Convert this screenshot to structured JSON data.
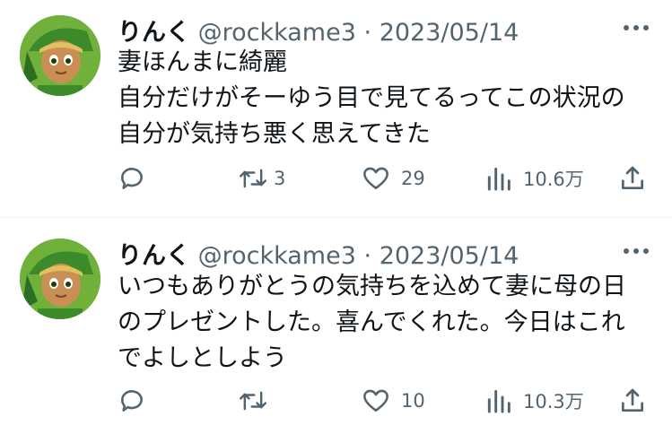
{
  "tweets": [
    {
      "author_name": "りんく",
      "handle": "@rockkame3",
      "separator": "·",
      "date": "2023/05/14",
      "lines": [
        "妻ほんまに綺麗",
        "自分だけがそーゆう目で見てるってこの状況の",
        "自分が気持ち悪く思えてきた"
      ],
      "actions": {
        "reply_count": "",
        "retweet_count": "3",
        "like_count": "29",
        "views_count": "10.6万"
      },
      "icons": [
        "reply-icon",
        "retweet-icon",
        "like-icon",
        "views-icon",
        "share-icon",
        "more-icon"
      ]
    },
    {
      "author_name": "りんく",
      "handle": "@rockkame3",
      "separator": "·",
      "date": "2023/05/14",
      "lines": [
        "いつもありがとうの気持ちを込めて妻に母の日",
        "のプレゼントした。喜んでくれた。今日はこれ",
        "でよしとしよう"
      ],
      "actions": {
        "reply_count": "",
        "retweet_count": "",
        "like_count": "10",
        "views_count": "10.3万"
      },
      "icons": [
        "reply-icon",
        "retweet-icon",
        "like-icon",
        "views-icon",
        "share-icon",
        "more-icon"
      ]
    }
  ],
  "colors": {
    "text": "#0f1419",
    "secondary": "#536471",
    "divider": "#eff3f4"
  }
}
